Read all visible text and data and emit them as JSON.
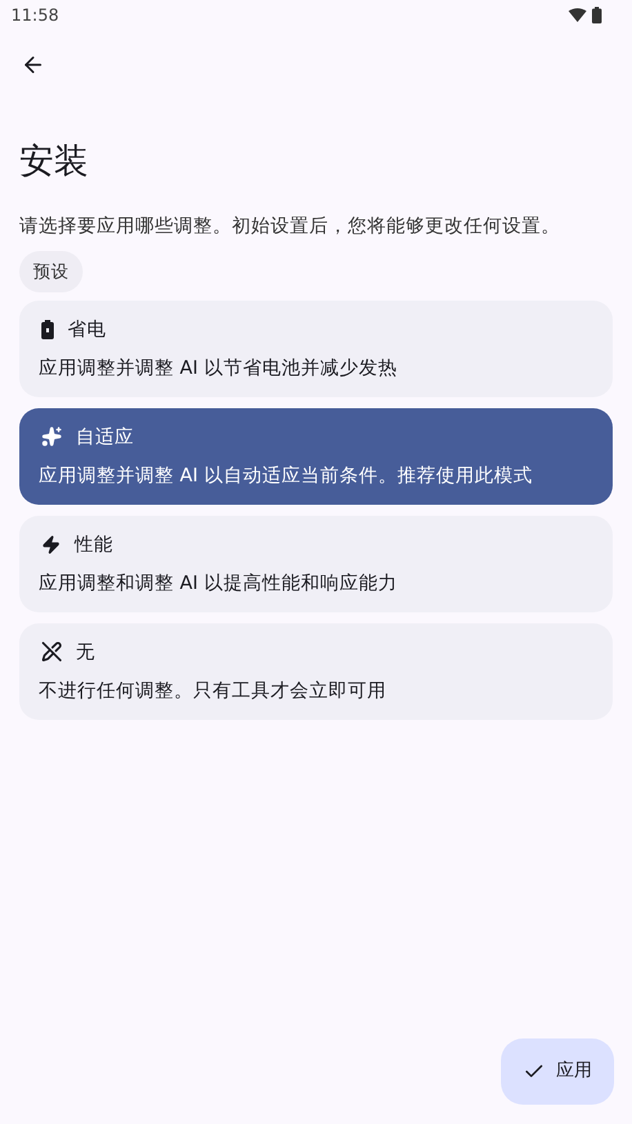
{
  "status_bar": {
    "time": "11:58"
  },
  "title": "安装",
  "description": "请选择要应用哪些调整。初始设置后，您将能够更改任何设置。",
  "chip": "预设",
  "options": [
    {
      "kind": "battery",
      "title": "省电",
      "subtitle": "应用调整并调整 AI 以节省电池并减少发热",
      "selected": false
    },
    {
      "kind": "adaptive",
      "title": "自适应",
      "subtitle": "应用调整并调整 AI 以自动适应当前条件。推荐使用此模式",
      "selected": true
    },
    {
      "kind": "performance",
      "title": "性能",
      "subtitle": "应用调整和调整 AI 以提高性能和响应能力",
      "selected": false
    },
    {
      "kind": "none",
      "title": "无",
      "subtitle": "不进行任何调整。只有工具才会立即可用",
      "selected": false
    }
  ],
  "fab": "应用"
}
